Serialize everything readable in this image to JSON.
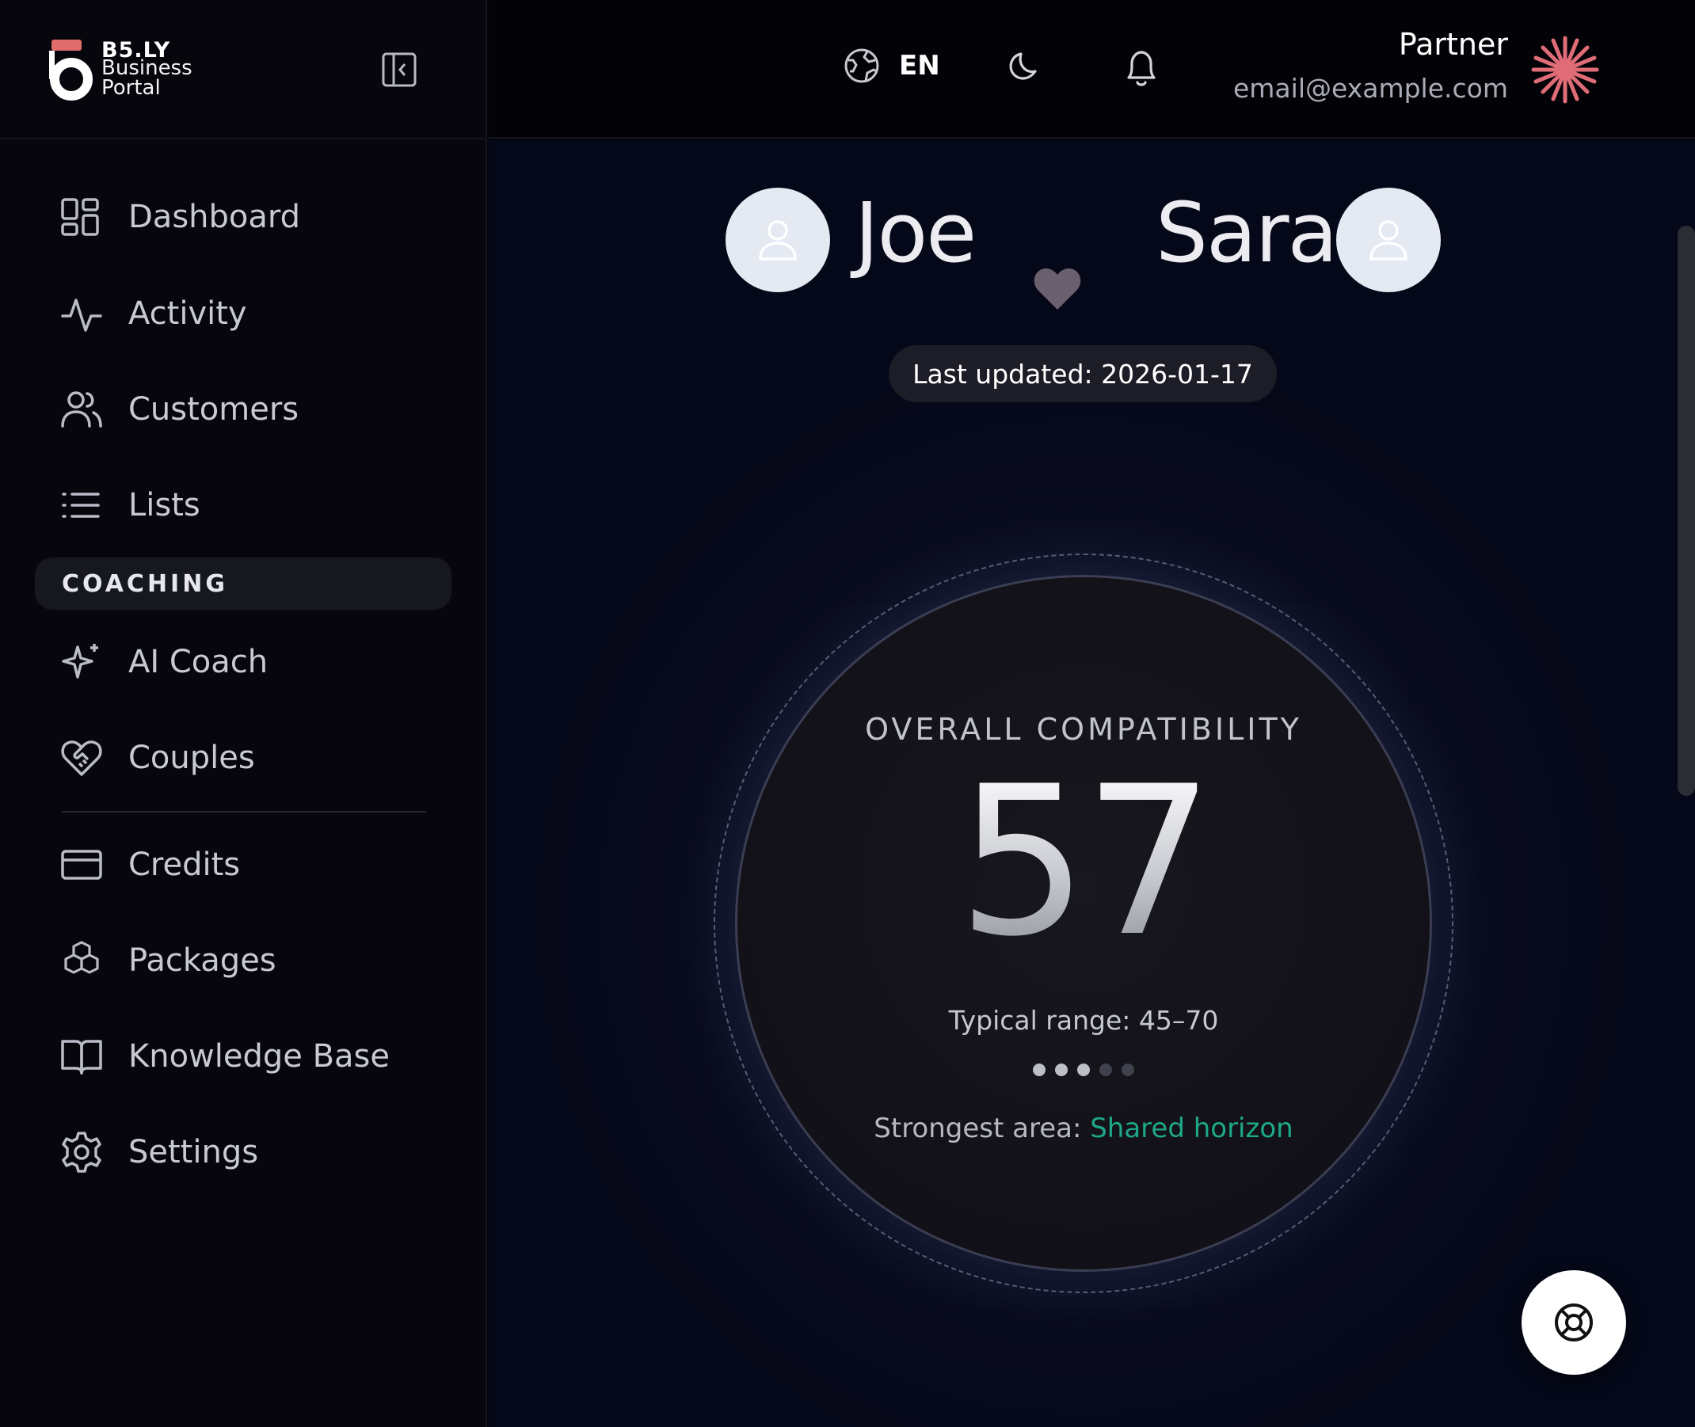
{
  "brand": {
    "name": "B5.LY",
    "subtitle": "Business Portal",
    "logo_color": "#e06c6c"
  },
  "sidebar": {
    "items": [
      {
        "label": "Dashboard",
        "icon": "dashboard-grid-icon"
      },
      {
        "label": "Activity",
        "icon": "activity-pulse-icon"
      },
      {
        "label": "Customers",
        "icon": "users-icon"
      },
      {
        "label": "Lists",
        "icon": "list-icon"
      }
    ],
    "section_label": "COACHING",
    "coaching_items": [
      {
        "label": "AI Coach",
        "icon": "sparkles-icon"
      },
      {
        "label": "Couples",
        "icon": "heart-handshake-icon"
      }
    ],
    "bottom_items": [
      {
        "label": "Credits",
        "icon": "credit-card-icon"
      },
      {
        "label": "Packages",
        "icon": "boxes-icon"
      },
      {
        "label": "Knowledge Base",
        "icon": "book-open-icon"
      },
      {
        "label": "Settings",
        "icon": "gear-icon"
      }
    ]
  },
  "header": {
    "language": "EN",
    "user_name": "Partner",
    "user_email": "email@example.com",
    "avatar_color": "#e06c78"
  },
  "couple": {
    "partner_a": "Joe",
    "partner_b": "Sara",
    "last_updated": "Last updated: 2026-01-17"
  },
  "compatibility": {
    "title": "OVERALL COMPATIBILITY",
    "score": "57",
    "typical_range": "Typical range: 45–70",
    "level": 3,
    "level_max": 5,
    "strongest_label": "Strongest area:",
    "strongest_value": "Shared horizon",
    "accent_color": "#1ea889"
  }
}
